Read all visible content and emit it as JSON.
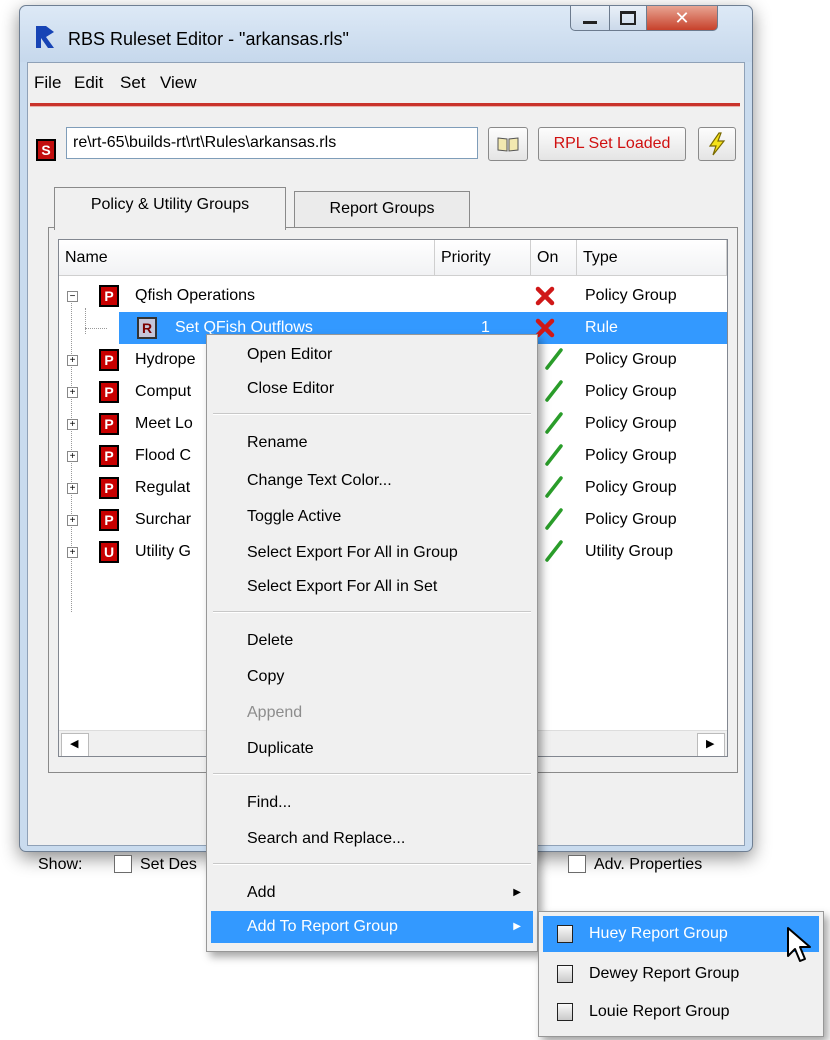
{
  "window": {
    "title": "RBS Ruleset Editor - \"arkansas.rls\""
  },
  "menubar": [
    "File",
    "Edit",
    "Set",
    "View"
  ],
  "toolbar": {
    "path": "re\\rt-65\\builds-rt\\rt\\Rules\\arkansas.rls",
    "rpl_button": "RPL Set Loaded",
    "set_icon": "S"
  },
  "tabs": [
    "Policy & Utility Groups",
    "Report Groups"
  ],
  "columns": [
    "Name",
    "Priority",
    "On",
    "Type"
  ],
  "rows": [
    {
      "name": "Qfish Operations",
      "priority": "",
      "on": "off",
      "type": "Policy Group",
      "badge": "P"
    },
    {
      "name": "Set QFish Outflows",
      "priority": "1",
      "on": "off",
      "type": "Rule",
      "badge": "R"
    },
    {
      "name": "Hydrope",
      "priority": "",
      "on": "on",
      "type": "Policy Group",
      "badge": "P"
    },
    {
      "name": "Comput",
      "priority": "",
      "on": "on",
      "type": "Policy Group",
      "badge": "P"
    },
    {
      "name": "Meet Lo",
      "priority": "",
      "on": "on",
      "type": "Policy Group",
      "badge": "P"
    },
    {
      "name": "Flood C",
      "priority": "",
      "on": "on",
      "type": "Policy Group",
      "badge": "P"
    },
    {
      "name": "Regulat",
      "priority": "",
      "on": "on",
      "type": "Policy Group",
      "badge": "P"
    },
    {
      "name": "Surchar",
      "priority": "",
      "on": "on",
      "type": "Policy Group",
      "badge": "P"
    },
    {
      "name": "Utility G",
      "priority": "",
      "on": "on",
      "type": "Utility Group",
      "badge": "U"
    }
  ],
  "show_bar": {
    "label": "Show:",
    "set_desc": "Set Des",
    "adv_props": "Adv. Properties"
  },
  "context_menu": {
    "items": [
      "Open Editor",
      "Close Editor",
      "Rename",
      "Change Text Color...",
      "Toggle Active",
      "Select Export For All in Group",
      "Select Export For All in Set",
      "Delete",
      "Copy",
      "Append",
      "Duplicate",
      "Find...",
      "Search and Replace...",
      "Add",
      "Add To Report Group"
    ]
  },
  "submenu": {
    "items": [
      "Huey Report Group",
      "Dewey Report Group",
      "Louie Report Group"
    ]
  },
  "colors": {
    "selection": "#3399ff",
    "accent_red": "#c80000",
    "check_green": "#2a9d2a"
  }
}
